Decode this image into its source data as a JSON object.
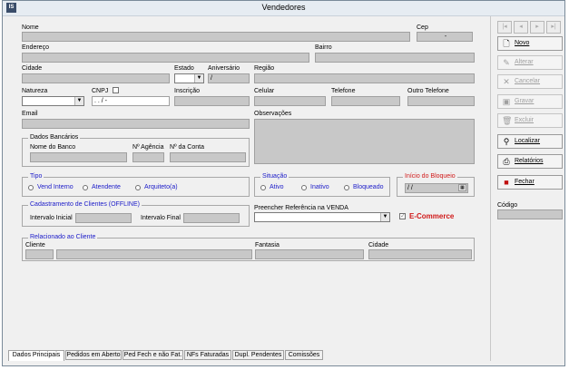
{
  "window": {
    "title": "Vendedores",
    "icon_text": "IS"
  },
  "fields": {
    "nome": "Nome",
    "cep": "Cep",
    "cep_value": "-",
    "endereco": "Endereço",
    "bairro": "Bairro",
    "cidade": "Cidade",
    "estado": "Estado",
    "aniversario": "Aniversário",
    "aniversario_value": "/",
    "regiao": "Região",
    "natureza": "Natureza",
    "cnpj": "CNPJ",
    "cnpj_value": ". . / -",
    "inscricao": "Inscrição",
    "celular": "Celular",
    "telefone": "Telefone",
    "outro_telefone": "Outro Telefone",
    "email": "Email",
    "observacoes": "Observações"
  },
  "bank": {
    "title": "Dados Bancários",
    "nome_banco": "Nome do Banco",
    "agencia": "Nº Agência",
    "conta": "Nº da Conta"
  },
  "tipo": {
    "title": "Tipo",
    "options": [
      "Vend Interno",
      "Atendente",
      "Arquiteto(a)"
    ]
  },
  "situacao": {
    "title": "Situação",
    "options": [
      "Ativo",
      "Inativo",
      "Bloqueado"
    ]
  },
  "bloqueio": {
    "title": "Início do Bloqueio",
    "value": "/ /"
  },
  "offline": {
    "title": "Cadastramento de Clientes (OFFLINE)",
    "inicial": "Intervalo Inicial",
    "final": "Intervalo Final"
  },
  "referencia": {
    "label": "Preencher Referência na VENDA"
  },
  "ecommerce": {
    "label": "E-Commerce",
    "check": "✓"
  },
  "relacionado": {
    "title": "Relacionado ao Cliente",
    "cliente": "Cliente",
    "fantasia": "Fantasia",
    "cidade": "Cidade"
  },
  "nav": [
    "|◂",
    "◂",
    "▸",
    "▸|"
  ],
  "buttons": {
    "novo": "Novo",
    "alterar": "Alterar",
    "cancelar": "Cancelar",
    "gravar": "Gravar",
    "excluir": "Excluir",
    "localizar": "Localizar",
    "relatorios": "Relatórios",
    "fechar": "Fechar"
  },
  "codigo": "Código",
  "tabs": [
    "Dados Principais",
    "Pedidos em Aberto",
    "Ped Fech e não Fat.",
    "NFs Faturadas",
    "Dupl. Pendentes",
    "Comissões"
  ],
  "colors": {
    "group_title_blue": "#1a1ac8",
    "ecommerce_red": "#d01818",
    "field_gray": "#c8c8c8"
  }
}
